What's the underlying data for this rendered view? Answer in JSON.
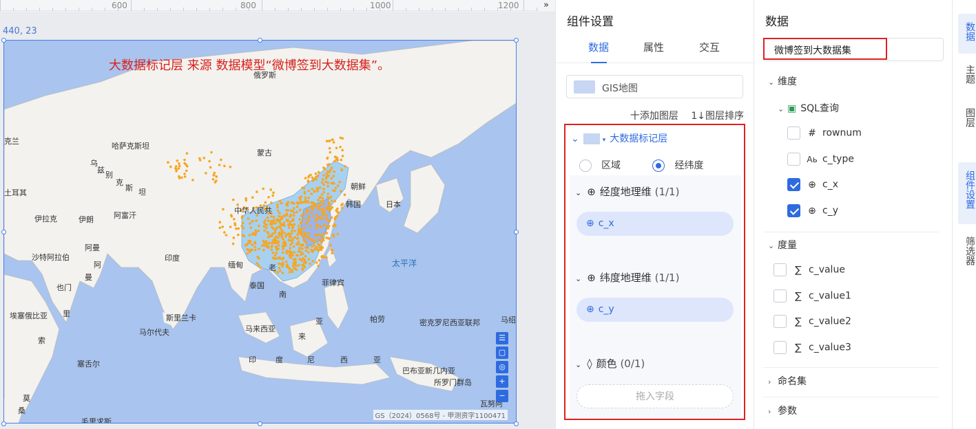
{
  "ruler": {
    "labels": [
      "600",
      "800",
      "1000",
      "1200"
    ],
    "arrow": "»"
  },
  "canvas": {
    "coord": "440, 23"
  },
  "map": {
    "title": "大数据标记层 来源 数据模型“微博签到大数据集”。",
    "copyright": "GS（2024）0568号 - 甲测资字1100471",
    "labels": {
      "russia": "俄罗斯",
      "kazakhstan": "哈萨克斯坦",
      "mongolia": "蒙古",
      "china": "中华人民共",
      "korea": "韩国",
      "japan": "日本",
      "north_korea": "朝鲜",
      "kaz_left": "克兰",
      "turkey": "土耳其",
      "iran": "伊拉克",
      "iran2": "伊朗",
      "afghan": "阿富汗",
      "oman": "阿曼",
      "saudi": "沙特阿拉伯",
      "a": "阿",
      "man": "曼",
      "yemen": "也门",
      "india": "印度",
      "myanmar": "缅甸",
      "lao": "老",
      "thailand": "泰国",
      "nan": "南",
      "philippines": "菲律宾",
      "pacific": "太平洋",
      "srilanka": "斯里兰卡",
      "maldives": "马尔代夫",
      "malaysia": "马来西亚",
      "ya": "亚",
      "lai": "来",
      "palau": "帕劳",
      "micronesia": "密克罗尼西亚联邦",
      "marshall": "马绍",
      "ethiopia": "埃塞俄比亚",
      "li": "里",
      "suo": "索",
      "seychelles": "塞舌尔",
      "indonesia_yin": "印",
      "indonesia_du": "度",
      "indonesia_ni": "尼",
      "indonesia_xi": "西",
      "indonesia_ya": "亚",
      "png": "巴布亚新几内亚",
      "solomon": "所罗门群岛",
      "vanuatu": "瓦努阿",
      "mauritius": "毛里求斯",
      "mo": "莫",
      "sang": "桑",
      "uzb1": "乌",
      "uzb2": "兹",
      "uzb3": "别",
      "uzb4": "克",
      "uzb5": "斯",
      "uzb6": "坦"
    }
  },
  "settings": {
    "title": "组件设置",
    "tabs": [
      "数据",
      "属性",
      "交互"
    ],
    "gis": "GIS地图",
    "add_layer": "十添加图层",
    "sort_layer": "1↓图层排序",
    "layer_name": "大数据标记层",
    "radio": {
      "region": "区域",
      "latlng": "经纬度"
    },
    "groups": {
      "lng": {
        "label": "经度地理维",
        "count": "(1/1)",
        "field": "c_x"
      },
      "lat": {
        "label": "纬度地理维",
        "count": "(1/1)",
        "field": "c_y"
      },
      "color": {
        "label": "颜色",
        "count": "(0/1)",
        "placeholder": "拖入字段"
      }
    }
  },
  "data_panel": {
    "title": "数据",
    "dataset": "微博签到大数据集",
    "dimension": "维度",
    "sql": "SQL查询",
    "dims": [
      {
        "name": "rownum",
        "icon": "#",
        "checked": false
      },
      {
        "name": "c_type",
        "icon": "Ab",
        "checked": false
      },
      {
        "name": "c_x",
        "icon": "globe",
        "checked": true
      },
      {
        "name": "c_y",
        "icon": "globe",
        "checked": true
      }
    ],
    "measure": "度量",
    "measures": [
      "c_value",
      "c_value1",
      "c_value2",
      "c_value3"
    ],
    "named_set": "命名集",
    "params": "参数"
  },
  "rail": [
    "数据",
    "主题",
    "图层",
    "组件设置",
    "筛选器"
  ],
  "colors": {
    "accent": "#2f6be0",
    "highlight": "#e02020",
    "points": "#f5a623"
  }
}
